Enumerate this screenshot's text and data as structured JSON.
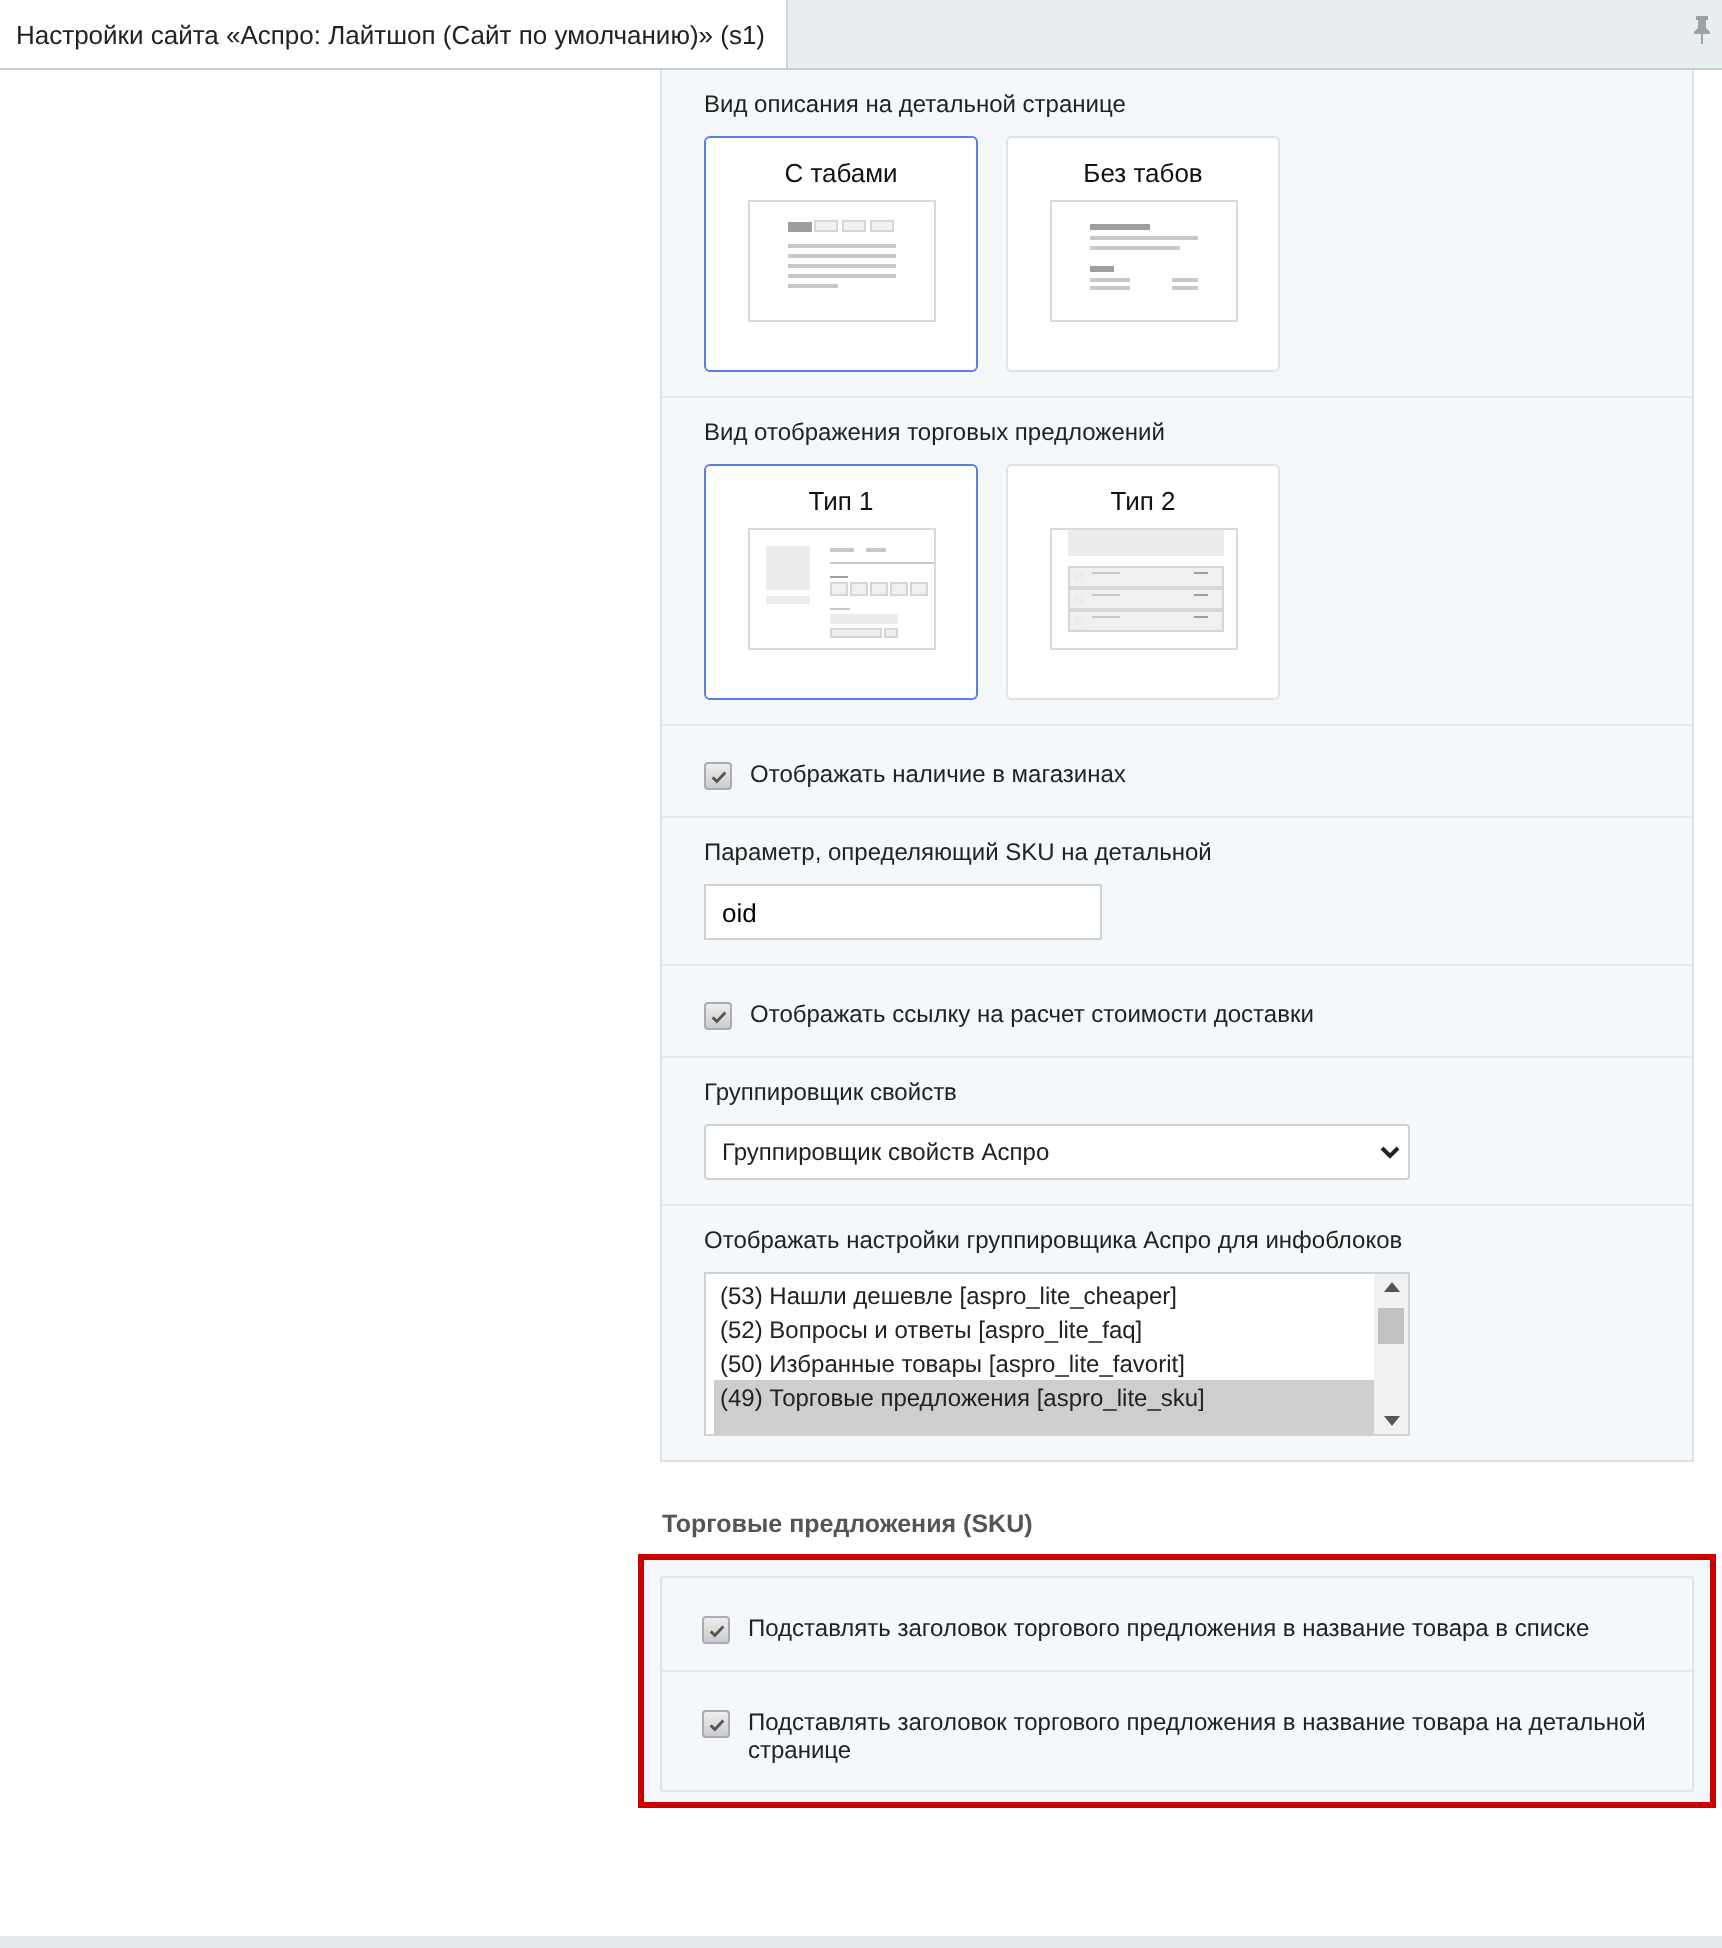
{
  "window": {
    "title": "Настройки сайта «Аспро: Лайтшоп (Сайт по умолчанию)» (s1)"
  },
  "sections": [
    {
      "kind": "choice",
      "label": "Вид описания на детальной странице",
      "options": [
        {
          "label": "С табами",
          "kind": "tabs",
          "selected": true
        },
        {
          "label": "Без табов",
          "kind": "notabs",
          "selected": false
        }
      ]
    },
    {
      "kind": "choice",
      "label": "Вид отображения торговых предложений",
      "options": [
        {
          "label": "Тип 1",
          "kind": "type1",
          "selected": true
        },
        {
          "label": "Тип 2",
          "kind": "type2",
          "selected": false
        }
      ]
    },
    {
      "kind": "checkbox",
      "label": "Отображать наличие в магазинах",
      "checked": true
    },
    {
      "kind": "text",
      "label": "Параметр, определяющий SKU на детальной",
      "value": "oid"
    },
    {
      "kind": "checkbox",
      "label": "Отображать ссылку на расчет стоимости доставки",
      "checked": true
    },
    {
      "kind": "select",
      "label": "Группировщик свойств",
      "value": "Группировщик свойств Аспро"
    },
    {
      "kind": "listbox",
      "label": "Отображать настройки группировщика Аспро для инфоблоков",
      "items": [
        {
          "label": "(53) Нашли дешевле [aspro_lite_cheaper]",
          "selected": false
        },
        {
          "label": "(52) Вопросы и ответы [aspro_lite_faq]",
          "selected": false
        },
        {
          "label": "(50) Избранные товары [aspro_lite_favorit]",
          "selected": false
        },
        {
          "label": "(49) Торговые предложения [aspro_lite_sku]",
          "selected": true
        }
      ]
    }
  ],
  "sku_group": {
    "title": "Торговые предложения (SKU)",
    "highlighted": true,
    "sections": [
      {
        "kind": "checkbox",
        "label": "Подставлять заголовок торгового предложения в название товара в списке",
        "checked": true
      },
      {
        "kind": "checkbox",
        "label": "Подставлять заголовок торгового предложения в название товара на детальной странице",
        "checked": true
      }
    ]
  }
}
